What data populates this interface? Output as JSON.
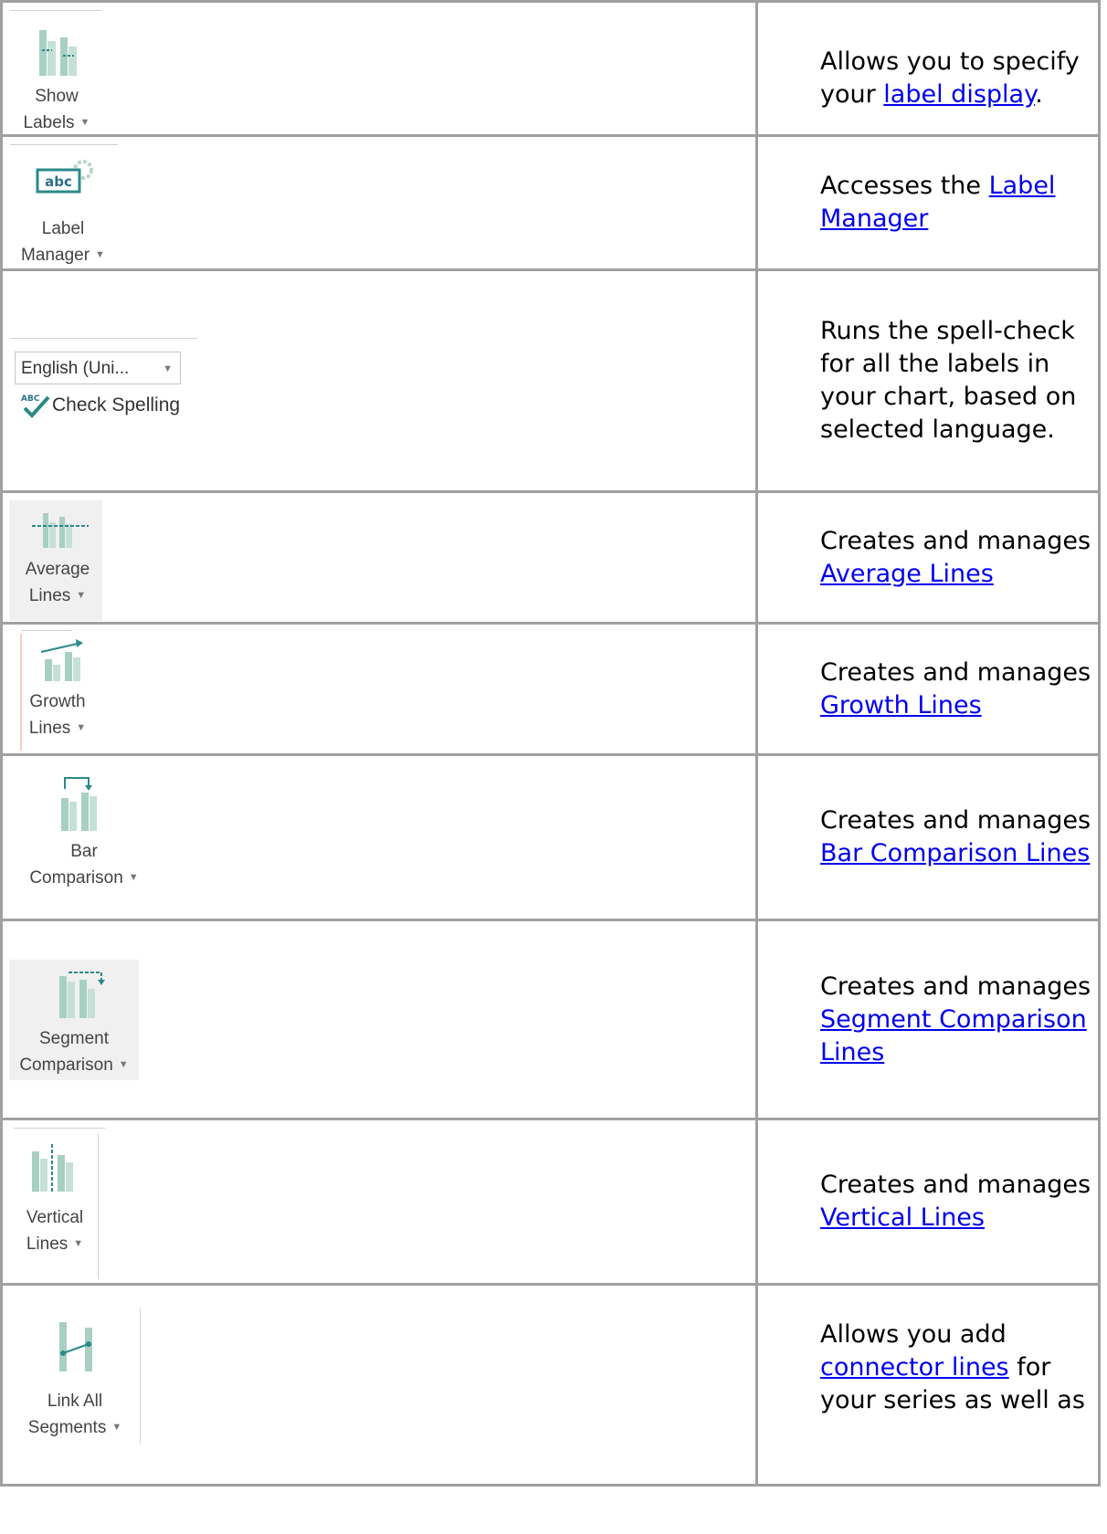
{
  "rows": [
    {
      "ribbon": [
        "Show",
        "Labels"
      ],
      "desc": [
        "Allows you to specify your "
      ],
      "link": "label display",
      "after": "."
    },
    {
      "ribbon": [
        "Label",
        "Manager"
      ],
      "icon_text": "abc",
      "desc": [
        "Accesses the "
      ],
      "link": "Label Manager",
      "after": ""
    },
    {
      "dropdown": "English (Uni...",
      "check": "Check Spelling",
      "check_icon_text": "ABC",
      "desc": "Runs the spell-check for all the labels in your chart, based on selected language."
    },
    {
      "ribbon": [
        "Average",
        "Lines"
      ],
      "desc": [
        "Creates and manages "
      ],
      "link": "Average Lines",
      "after": ""
    },
    {
      "ribbon": [
        "Growth",
        "Lines"
      ],
      "desc": [
        "Creates and manages "
      ],
      "link": "Growth Lines",
      "after": ""
    },
    {
      "ribbon": [
        "Bar",
        "Comparison"
      ],
      "desc": [
        "Creates and manages "
      ],
      "link": "Bar Comparison Lines",
      "after": ""
    },
    {
      "ribbon": [
        "Segment",
        "Comparison"
      ],
      "desc": [
        "Creates and manages "
      ],
      "link": "Segment Comparison Lines",
      "after": ""
    },
    {
      "ribbon": [
        "Vertical",
        "Lines"
      ],
      "desc": [
        "Creates and manages "
      ],
      "link": "Vertical Lines",
      "after": ""
    },
    {
      "ribbon": [
        "Link All",
        "Segments"
      ],
      "desc": [
        "Allows you add "
      ],
      "link": "connector lines",
      "after": " for your series as well as"
    }
  ],
  "colors": {
    "teal": "#2b8a8a",
    "pale_teal": "#b7d8cc",
    "border": "#a0a0a0",
    "link": "#0000ee"
  }
}
